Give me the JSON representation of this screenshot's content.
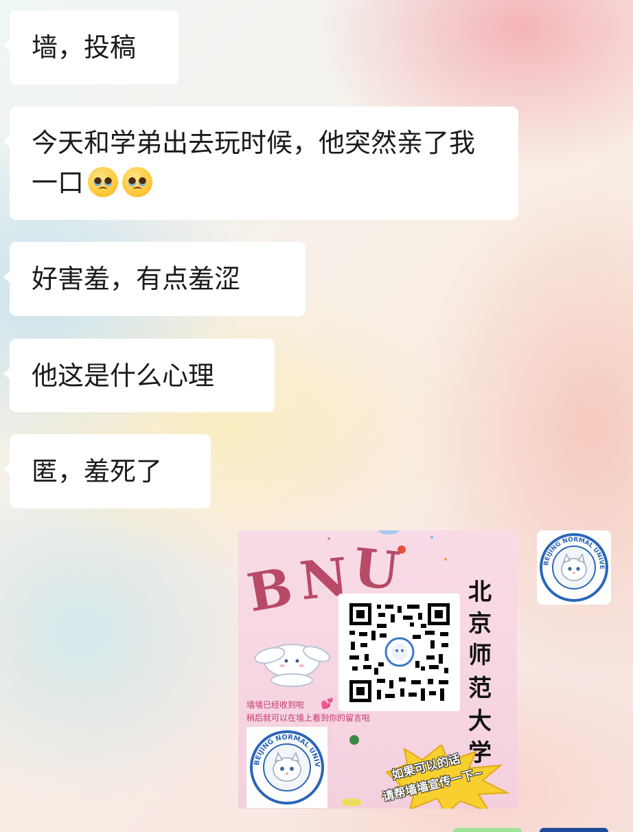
{
  "messages": [
    {
      "text": "墙，投稿"
    },
    {
      "text": "今天和学弟出去玩时候，他突然亲了我一口",
      "emoji": [
        "pleading-face",
        "pleading-face"
      ]
    },
    {
      "text": "好害羞，有点羞涩"
    },
    {
      "text": "他这是什么心理"
    },
    {
      "text": "匿，羞死了"
    }
  ],
  "poster": {
    "letters": [
      "B",
      "N",
      "U"
    ],
    "vertical_title": [
      "北",
      "京",
      "师",
      "范",
      "大",
      "学"
    ],
    "caption_line1": "墙墙已经收到啦",
    "caption_line2": "稍后就可以在墙上看到你的留言啦",
    "burst_line1": "如果可以的话",
    "burst_line2": "请帮墙墙宣传一下~",
    "logo_text": "BEIJING NORMAL UNIVERSITY",
    "colors": {
      "pink_bg": "#f6d5e2",
      "letter": "#b84a67",
      "caption": "#c4386a",
      "burst": "#f7cf2f"
    }
  },
  "avatar": {
    "logo_text": "BEIJING NORMAL UNIVERSITY",
    "ring_color": "#2a66b8"
  }
}
